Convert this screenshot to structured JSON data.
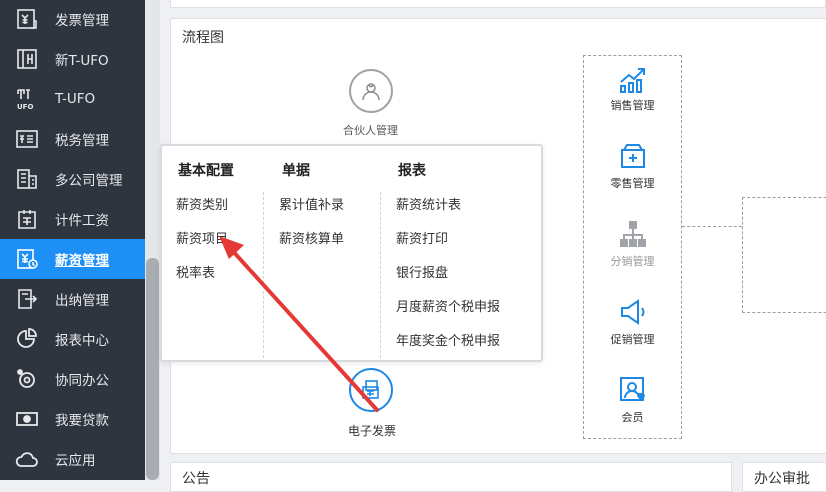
{
  "sidebar": {
    "items": [
      {
        "label": "发票管理",
        "icon": "invoice-icon"
      },
      {
        "label": "新T-UFO",
        "icon": "new-tufo-icon"
      },
      {
        "label": "T-UFO",
        "icon": "tufo-icon"
      },
      {
        "label": "税务管理",
        "icon": "tax-icon"
      },
      {
        "label": "多公司管理",
        "icon": "multi-company-icon"
      },
      {
        "label": "计件工资",
        "icon": "piece-wage-icon"
      },
      {
        "label": "薪资管理",
        "icon": "salary-icon",
        "active": true
      },
      {
        "label": "出纳管理",
        "icon": "cashier-icon"
      },
      {
        "label": "报表中心",
        "icon": "report-icon"
      },
      {
        "label": "协同办公",
        "icon": "collab-icon"
      },
      {
        "label": "我要贷款",
        "icon": "loan-icon"
      },
      {
        "label": "云应用",
        "icon": "cloud-icon"
      }
    ]
  },
  "flow": {
    "title": "流程图",
    "partner_label": "合伙人管理",
    "einvoice_label": "电子发票",
    "right_items": [
      {
        "label": "销售管理",
        "icon": "sales-chart-icon"
      },
      {
        "label": "零售管理",
        "icon": "retail-icon"
      },
      {
        "label": "分销管理",
        "icon": "distribution-icon",
        "dim": true
      },
      {
        "label": "促销管理",
        "icon": "megaphone-icon"
      },
      {
        "label": "会员",
        "icon": "member-icon"
      }
    ]
  },
  "dropdown": {
    "columns": [
      {
        "header": "基本配置",
        "items": [
          "薪资类别",
          "薪资项目",
          "税率表"
        ]
      },
      {
        "header": "单据",
        "items": [
          "累计值补录",
          "薪资核算单"
        ]
      },
      {
        "header": "报表",
        "items": [
          "薪资统计表",
          "薪资打印",
          "银行报盘",
          "月度薪资个税申报",
          "年度奖金个税申报"
        ]
      }
    ]
  },
  "bottom": {
    "notice_title": "公告",
    "approve_title": "办公审批"
  },
  "colors": {
    "sidebar_bg": "#2f353f",
    "active_bg": "#1e90f5",
    "accent_blue": "#1e88e5",
    "annotation_arrow": "#e53935"
  }
}
